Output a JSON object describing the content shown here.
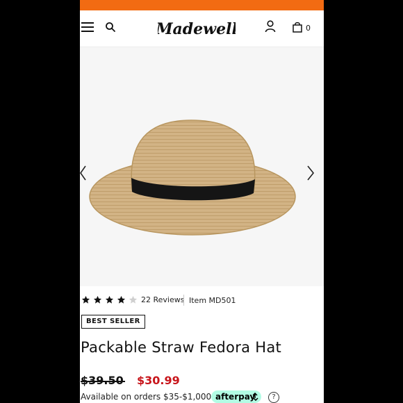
{
  "brand": {
    "logo_text": "Madewell",
    "accent_color": "#f26b12"
  },
  "header": {
    "cart_count": "0",
    "icons": [
      "menu-icon",
      "search-icon",
      "account-icon",
      "shopping-bag-icon"
    ]
  },
  "carousel": {
    "icons": [
      "chevron-left-icon",
      "chevron-right-icon"
    ]
  },
  "product": {
    "rating": 4,
    "rating_max": 5,
    "reviews_label": "22 Reviews",
    "item_number": "Item MD501",
    "badge": "BEST SELLER",
    "title": "Packable Straw Fedora Hat",
    "original_price": "$39.50",
    "sale_price": "$30.99",
    "sale_color": "#c8151b"
  },
  "afterpay": {
    "text": "Available on orders $35-$1,000 by",
    "label": "afterpay",
    "help": "?",
    "badge_color": "#b2fce4"
  }
}
